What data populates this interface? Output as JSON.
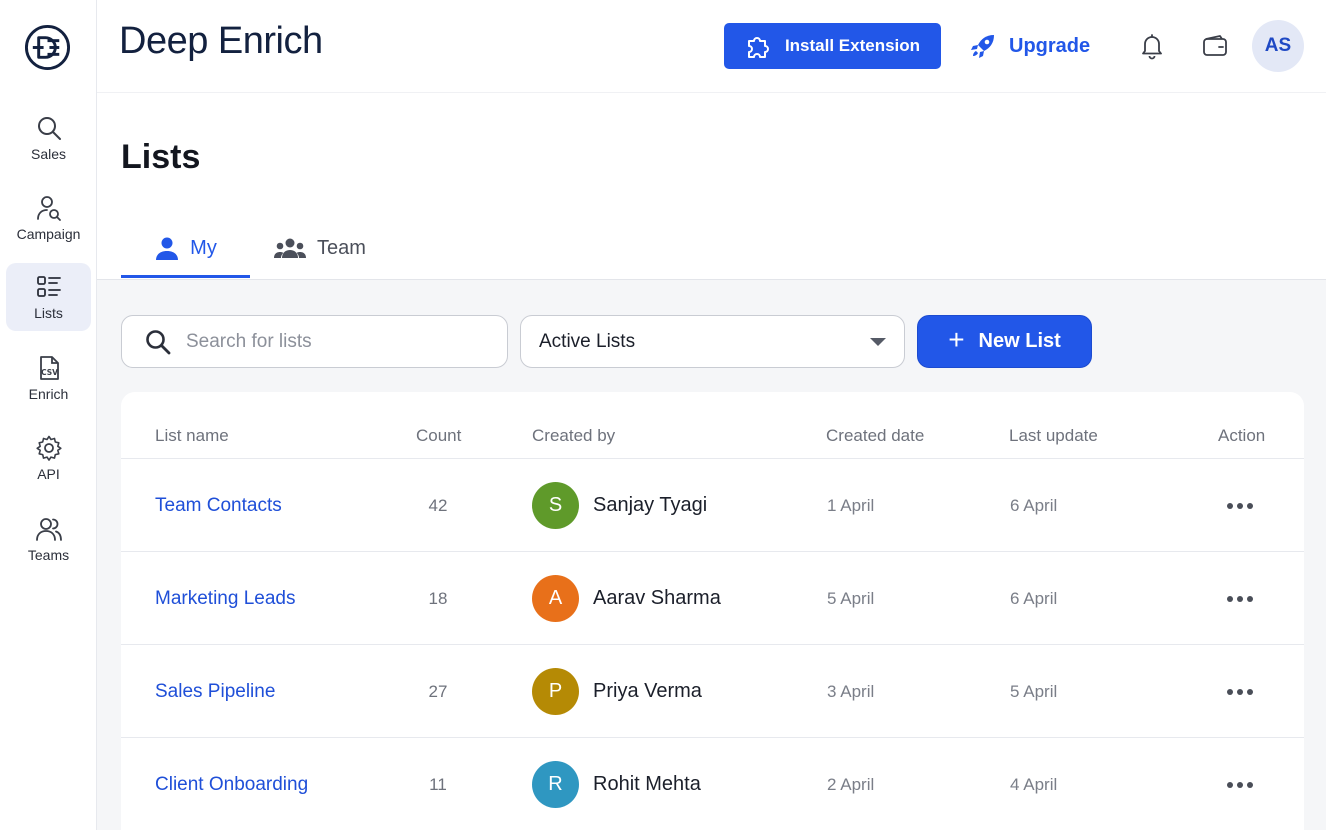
{
  "app": {
    "brand": "Deep Enrich"
  },
  "sidebar": {
    "items": [
      {
        "label": "Sales",
        "icon": "search-icon"
      },
      {
        "label": "Campaign",
        "icon": "user-search-icon"
      },
      {
        "label": "Lists",
        "icon": "list-icon",
        "active": true
      },
      {
        "label": "Enrich",
        "icon": "csv-file-icon"
      },
      {
        "label": "API",
        "icon": "gear-icon"
      },
      {
        "label": "Teams",
        "icon": "users-icon"
      }
    ]
  },
  "header": {
    "install_label": "Install Extension",
    "upgrade_label": "Upgrade",
    "avatar_initials": "AS"
  },
  "page": {
    "title": "Lists"
  },
  "tabs": [
    {
      "label": "My",
      "active": true
    },
    {
      "label": "Team",
      "active": false
    }
  ],
  "toolbar": {
    "search_placeholder": "Search for lists",
    "filter_value": "Active Lists",
    "new_list_label": "New List"
  },
  "table": {
    "columns": [
      "List name",
      "Count",
      "Created by",
      "Created date",
      "Last update",
      "Action"
    ],
    "rows": [
      {
        "name": "Team Contacts",
        "count": "42",
        "initial": "S",
        "creator": "Sanjay Tyagi",
        "created": "1 April",
        "updated": "6 April",
        "avatar_color": "#5f9a2a"
      },
      {
        "name": "Marketing Leads",
        "count": "18",
        "initial": "A",
        "creator": "Aarav Sharma",
        "created": "5 April",
        "updated": "6 April",
        "avatar_color": "#e8701a"
      },
      {
        "name": "Sales Pipeline",
        "count": "27",
        "initial": "P",
        "creator": "Priya Verma",
        "created": "3 April",
        "updated": "5 April",
        "avatar_color": "#b58a05"
      },
      {
        "name": "Client Onboarding",
        "count": "11",
        "initial": "R",
        "creator": "Rohit Mehta",
        "created": "2 April",
        "updated": "4 April",
        "avatar_color": "#2f97c1"
      }
    ]
  },
  "colors": {
    "accent": "#2257e8",
    "link": "#1f4fd8"
  }
}
